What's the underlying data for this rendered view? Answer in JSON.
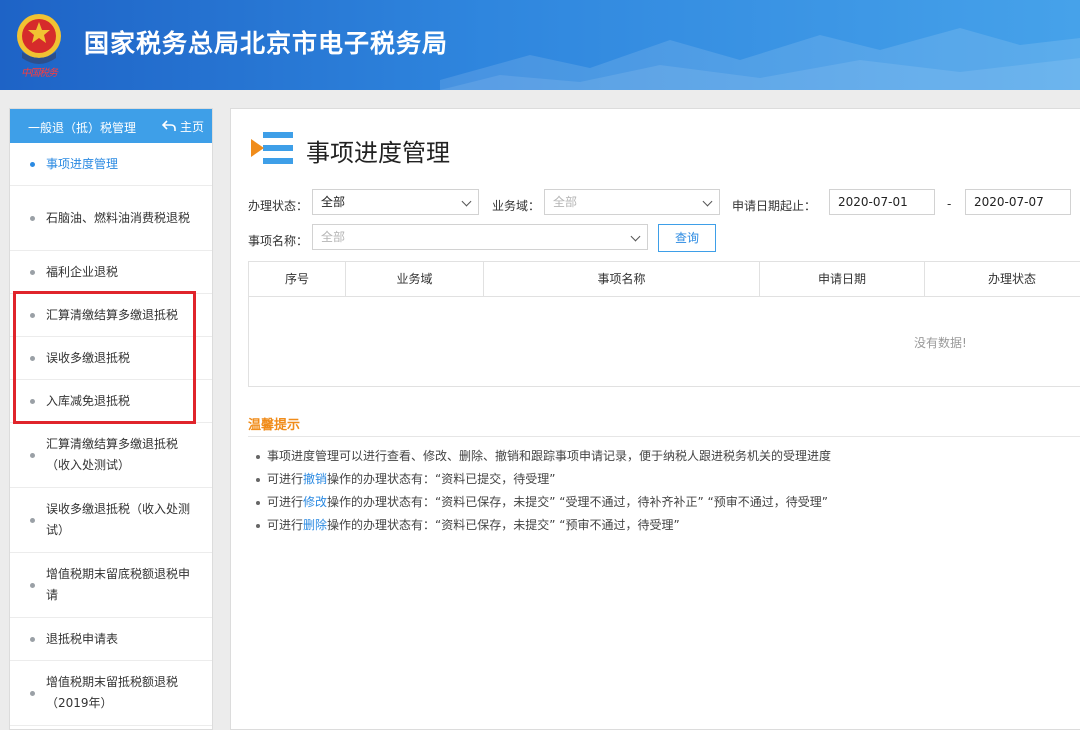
{
  "header": {
    "title": "国家税务总局北京市电子税务局",
    "emblem_text": "中国税务"
  },
  "sidebar": {
    "header_title": "一般退（抵）税管理",
    "home_label": "主页",
    "items": [
      {
        "label": "事项进度管理"
      },
      {
        "label": "石脑油、燃料油消费税退税"
      },
      {
        "label": "福利企业退税"
      },
      {
        "label": "汇算清缴结算多缴退抵税"
      },
      {
        "label": "误收多缴退抵税"
      },
      {
        "label": "入库减免退抵税"
      },
      {
        "label": "汇算清缴结算多缴退抵税（收入处测试）"
      },
      {
        "label": "误收多缴退抵税（收入处测试）"
      },
      {
        "label": "增值税期末留底税额退税申请"
      },
      {
        "label": "退抵税申请表"
      },
      {
        "label": "增值税期末留抵税额退税（2019年）"
      }
    ]
  },
  "main": {
    "title": "事项进度管理",
    "filters": {
      "status_label": "办理状态：",
      "status_value": "全部",
      "domain_label": "业务域：",
      "domain_placeholder": "全部",
      "date_label": "申请日期起止：",
      "date_start": "2020-07-01",
      "date_sep": "-",
      "date_end": "2020-07-07",
      "item_label": "事项名称：",
      "item_placeholder": "全部",
      "query_button": "查询"
    },
    "table": {
      "columns": [
        "序号",
        "业务域",
        "事项名称",
        "申请日期",
        "办理状态"
      ],
      "empty_text": "没有数据!"
    },
    "tips": {
      "title": "温馨提示",
      "line1": "事项进度管理可以进行查看、修改、删除、撤销和跟踪事项申请记录，便于纳税人跟进税务机关的受理进度",
      "line2_pre": "可进行",
      "line2_link": "撤销",
      "line2_post": "操作的办理状态有：“资料已提交，待受理”",
      "line3_pre": "可进行",
      "line3_link": "修改",
      "line3_post": "操作的办理状态有：“资料已保存，未提交”  “受理不通过，待补齐补正”  “预审不通过，待受理”",
      "line4_pre": "可进行",
      "line4_link": "删除",
      "line4_post": "操作的办理状态有：“资料已保存，未提交”  “预审不通过，待受理”"
    }
  },
  "colors": {
    "header_blue": "#2f86de",
    "accent_blue": "#3e9fe8",
    "highlight_red": "#e0242b",
    "tips_orange": "#f08c1a"
  }
}
